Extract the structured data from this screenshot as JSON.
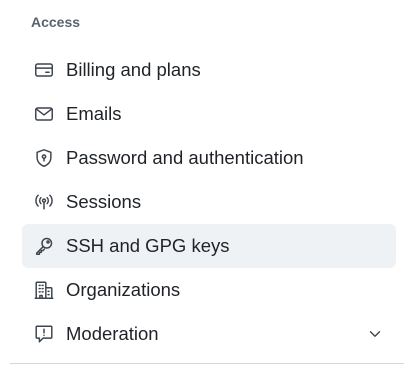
{
  "section": {
    "heading": "Access"
  },
  "nav": {
    "items": [
      {
        "label": "Billing and plans",
        "icon": "credit-card-icon",
        "selected": false
      },
      {
        "label": "Emails",
        "icon": "mail-icon",
        "selected": false
      },
      {
        "label": "Password and authentication",
        "icon": "shield-lock-icon",
        "selected": false
      },
      {
        "label": "Sessions",
        "icon": "broadcast-icon",
        "selected": false
      },
      {
        "label": "SSH and GPG keys",
        "icon": "key-icon",
        "selected": true
      },
      {
        "label": "Organizations",
        "icon": "organization-icon",
        "selected": false
      },
      {
        "label": "Moderation",
        "icon": "report-icon",
        "selected": false,
        "expandable": true
      }
    ]
  },
  "colors": {
    "selected_background": "#eff2f5",
    "heading_text": "#59636e",
    "item_text": "#1f2328",
    "icon_stroke": "#3d444d",
    "divider": "#d1d9e0"
  }
}
